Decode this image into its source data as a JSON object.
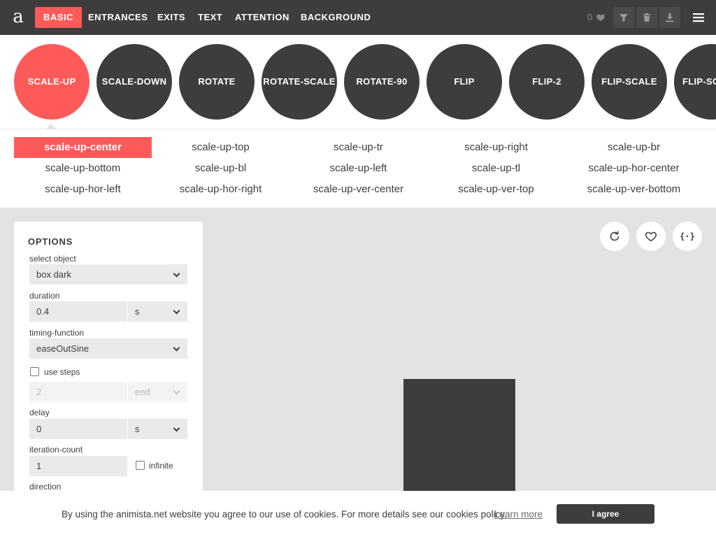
{
  "app": {
    "logo": "a"
  },
  "nav": {
    "tabs": [
      {
        "label": "BASIC",
        "active": true
      },
      {
        "label": "ENTRANCES",
        "active": false
      },
      {
        "label": "EXITS",
        "active": false
      },
      {
        "label": "TEXT",
        "active": false
      },
      {
        "label": "ATTENTION",
        "active": false
      },
      {
        "label": "BACKGROUND",
        "active": false
      }
    ],
    "favorites_count": "0",
    "icons": [
      "heart-icon",
      "filter-icon",
      "trash-icon",
      "download-icon",
      "menu-icon"
    ]
  },
  "animations": [
    {
      "label": "SCALE-UP",
      "active": true
    },
    {
      "label": "SCALE-DOWN",
      "active": false
    },
    {
      "label": "ROTATE",
      "active": false
    },
    {
      "label": "ROTATE-SCALE",
      "active": false
    },
    {
      "label": "ROTATE-90",
      "active": false
    },
    {
      "label": "FLIP",
      "active": false
    },
    {
      "label": "FLIP-2",
      "active": false
    },
    {
      "label": "FLIP-SCALE",
      "active": false
    },
    {
      "label": "FLIP-SC",
      "active": false
    }
  ],
  "variants": [
    {
      "label": "scale-up-center",
      "active": true
    },
    {
      "label": "scale-up-top",
      "active": false
    },
    {
      "label": "scale-up-tr",
      "active": false
    },
    {
      "label": "scale-up-right",
      "active": false
    },
    {
      "label": "scale-up-br",
      "active": false
    },
    {
      "label": "scale-up-bottom",
      "active": false
    },
    {
      "label": "scale-up-bl",
      "active": false
    },
    {
      "label": "scale-up-left",
      "active": false
    },
    {
      "label": "scale-up-tl",
      "active": false
    },
    {
      "label": "scale-up-hor-center",
      "active": false
    },
    {
      "label": "scale-up-hor-left",
      "active": false
    },
    {
      "label": "scale-up-hor-right",
      "active": false
    },
    {
      "label": "scale-up-ver-center",
      "active": false
    },
    {
      "label": "scale-up-ver-top",
      "active": false
    },
    {
      "label": "scale-up-ver-bottom",
      "active": false
    }
  ],
  "options": {
    "title": "OPTIONS",
    "select_object": {
      "label": "select object",
      "value": "box dark"
    },
    "duration": {
      "label": "duration",
      "value": "0.4",
      "unit": "s"
    },
    "timing_function": {
      "label": "timing-function",
      "value": "easeOutSine"
    },
    "use_steps": {
      "label": "use steps",
      "checked": false,
      "steps": "2",
      "position": "end"
    },
    "delay": {
      "label": "delay",
      "value": "0",
      "unit": "s"
    },
    "iteration_count": {
      "label": "iteration-count",
      "value": "1",
      "infinite_label": "infinite",
      "infinite_checked": false
    },
    "direction": {
      "label": "direction"
    }
  },
  "preview": {
    "actions": [
      "replay-icon",
      "heart-icon",
      "code-icon"
    ],
    "code_glyph": "{·}"
  },
  "cookie": {
    "text": "By using the animista.net website you agree to our use of cookies. For more details see our cookies policy.",
    "link": "Learn more",
    "button": "I agree"
  },
  "colors": {
    "accent": "#ff5a5a",
    "dark": "#3d3d3d",
    "background": "#e3e3e3"
  }
}
